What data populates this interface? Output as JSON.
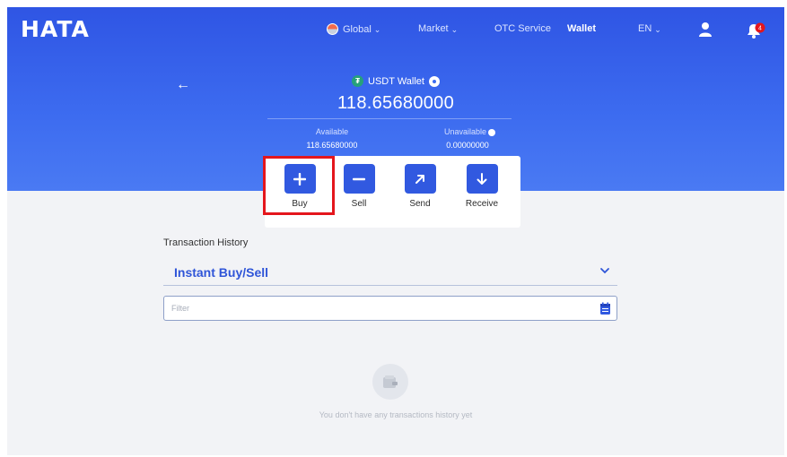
{
  "header": {
    "logo": "HATA",
    "nav": [
      {
        "label": "Global",
        "icon": "globe-icon",
        "dropdown": true
      },
      {
        "label": "Market",
        "dropdown": true
      },
      {
        "label": "OTC Service",
        "dropdown": false
      },
      {
        "label": "Wallet",
        "dropdown": false,
        "active": true
      },
      {
        "label": "EN",
        "dropdown": true
      }
    ],
    "notification_count": "4"
  },
  "wallet": {
    "title": "USDT Wallet",
    "balance": "118.65680000",
    "available_label": "Available",
    "available_value": "118.65680000",
    "unavailable_label": "Unavailable",
    "unavailable_value": "0.00000000"
  },
  "actions": [
    {
      "label": "Buy",
      "icon": "plus-icon",
      "highlighted": true
    },
    {
      "label": "Sell",
      "icon": "minus-icon"
    },
    {
      "label": "Send",
      "icon": "arrow-up-right-icon"
    },
    {
      "label": "Receive",
      "icon": "arrow-down-icon"
    }
  ],
  "history": {
    "label": "Transaction History",
    "type_selected": "Instant Buy/Sell",
    "filter_placeholder": "Filter",
    "empty_text": "You don't have any transactions history yet"
  },
  "colors": {
    "brand": "#3159e0",
    "highlight": "#e4161c",
    "coin": "#26a17b"
  }
}
